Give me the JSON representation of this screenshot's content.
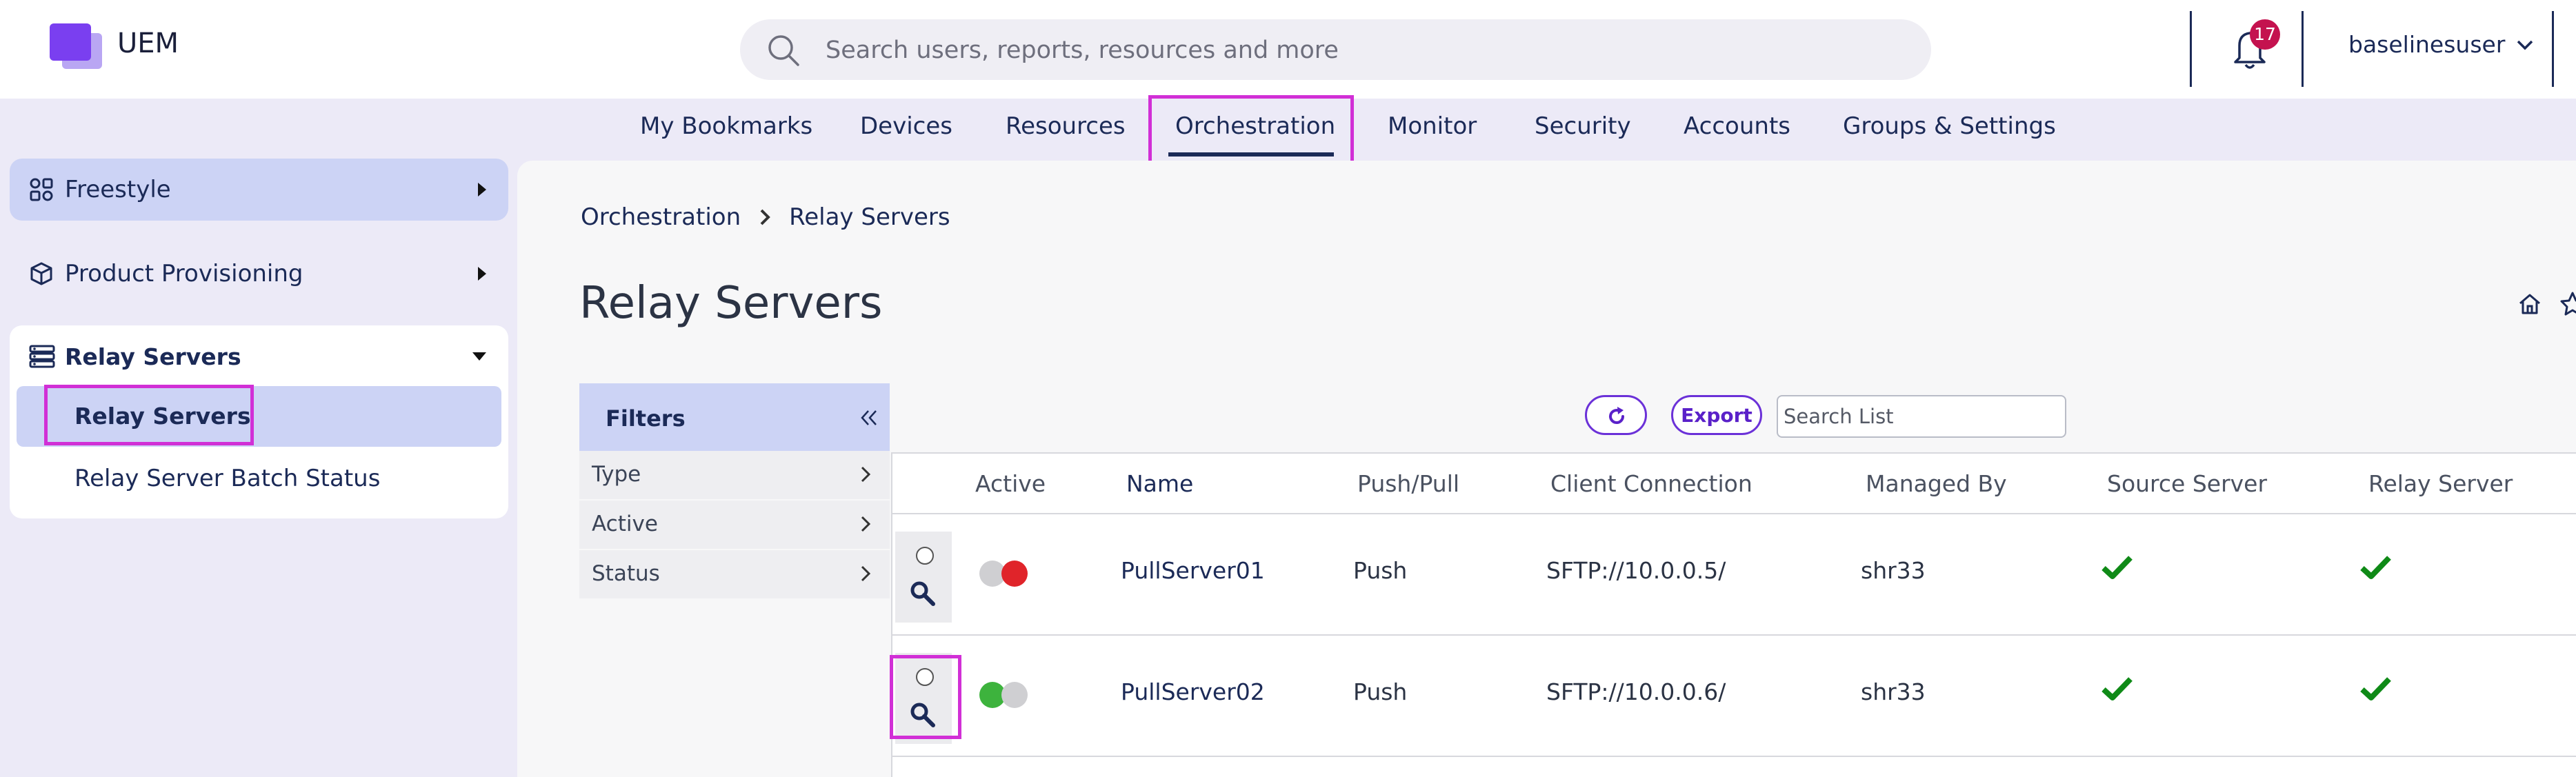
{
  "header": {
    "app_name": "UEM",
    "search_placeholder": "Search users, reports, resources and more",
    "notification_count": "17",
    "username": "baselinesuser"
  },
  "topnav": {
    "items": [
      "My Bookmarks",
      "Devices",
      "Resources",
      "Orchestration",
      "Monitor",
      "Security",
      "Accounts",
      "Groups & Settings"
    ],
    "active": "Orchestration"
  },
  "sidebar": {
    "freestyle": "Freestyle",
    "provisioning": "Product Provisioning",
    "relay_group": "Relay Servers",
    "relay_items": [
      "Relay Servers",
      "Relay Server Batch Status"
    ]
  },
  "breadcrumb": [
    "Orchestration",
    "Relay Servers"
  ],
  "page_title": "Relay Servers",
  "filters": {
    "title": "Filters",
    "items": [
      "Type",
      "Active",
      "Status"
    ]
  },
  "toolbar": {
    "export_label": "Export",
    "search_placeholder": "Search List"
  },
  "grid": {
    "columns": [
      "Active",
      "Name",
      "Push/Pull",
      "Client Connection",
      "Managed By",
      "Source Server",
      "Relay Server"
    ],
    "rows": [
      {
        "active": false,
        "name": "PullServer01",
        "push_pull": "Push",
        "client_connection": "SFTP://10.0.0.5/",
        "managed_by": "shr33",
        "source_server": true,
        "relay_server": true
      },
      {
        "active": true,
        "name": "PullServer02",
        "push_pull": "Push",
        "client_connection": "SFTP://10.0.0.6/",
        "managed_by": "shr33",
        "source_server": true,
        "relay_server": true
      }
    ]
  },
  "colors": {
    "accent": "#6b31d8",
    "highlight_outline": "#d12fd6",
    "active_green": "#3db33d",
    "inactive_red": "#e0242a",
    "check_green": "#0f8a17",
    "selected_bg": "#ccd3f5"
  },
  "icons": {
    "logo": "uem-logo-icon",
    "search": "search-icon",
    "bell": "bell-icon",
    "user_caret": "chevron-down-icon",
    "freestyle": "freestyle-icon",
    "provisioning": "package-icon",
    "relay": "server-stack-icon",
    "home": "home-icon",
    "star": "star-icon",
    "refresh": "refresh-icon",
    "view": "magnifier-icon",
    "check": "checkmark-icon"
  }
}
